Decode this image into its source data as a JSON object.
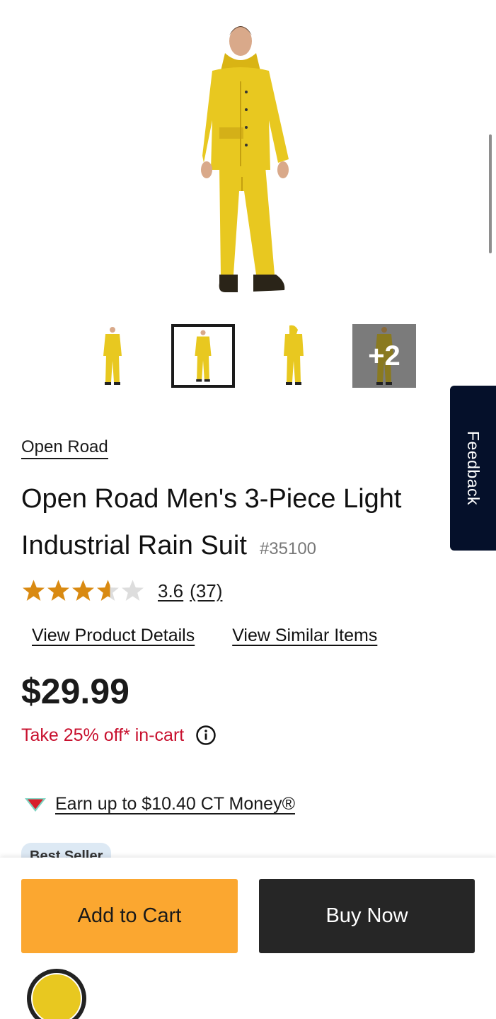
{
  "gallery": {
    "more_count": "+2",
    "selected_index": 1
  },
  "feedback_tab": {
    "label": "Feedback"
  },
  "product": {
    "brand": "Open Road",
    "title": "Open Road Men's 3-Piece Light Industrial Rain Suit",
    "sku": "#35100",
    "rating": {
      "value": "3.6",
      "count": "(37)",
      "stars_filled": 3.6,
      "stars_max": 5
    },
    "links": {
      "details": "View Product Details",
      "similar": "View Similar Items"
    },
    "price": "$29.99",
    "promo": "Take 25% off* in-cart",
    "ct_money": "Earn up to $10.40 CT Money®",
    "badge": "Best Seller"
  },
  "actions": {
    "add_to_cart": "Add to Cart",
    "buy_now": "Buy Now"
  },
  "colors": {
    "suit": "#e8c820",
    "add_button": "#fba730",
    "buy_button": "#262626",
    "promo_text": "#c8102e",
    "star_filled": "#d98a12",
    "star_empty": "#dddddd"
  }
}
